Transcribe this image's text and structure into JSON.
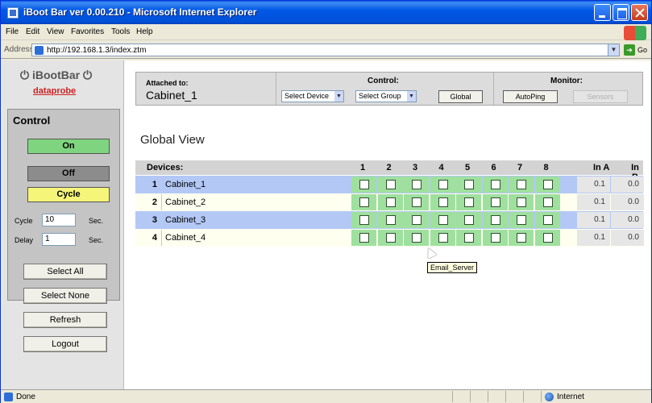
{
  "window": {
    "title": "iBoot Bar ver 0.00.210 - Microsoft Internet Explorer"
  },
  "menu": [
    "File",
    "Edit",
    "View",
    "Favorites",
    "Tools",
    "Help"
  ],
  "address": {
    "label": "Address",
    "url": "http://192.168.1.3/index.ztm",
    "go_label": "Go"
  },
  "logo": {
    "product": "iBootBar",
    "brand": "dataprobe"
  },
  "control": {
    "title": "Control",
    "on_label": "On",
    "off_label": "Off",
    "cycle_label": "Cycle",
    "cycle_field_label": "Cycle",
    "cycle_value": "10",
    "cycle_unit": "Sec.",
    "delay_field_label": "Delay",
    "delay_value": "1",
    "delay_unit": "Sec."
  },
  "side_buttons": {
    "select_all": "Select All",
    "select_none": "Select None",
    "refresh": "Refresh",
    "logout": "Logout"
  },
  "header": {
    "attached_label": "Attached to:",
    "attached_value": "Cabinet_1",
    "control_title": "Control:",
    "select_device": "Select Device",
    "select_group": "Select Group",
    "global_button": "Global",
    "monitor_title": "Monitor:",
    "autoping_button": "AutoPing",
    "sensors_button": "Sensors"
  },
  "view_title": "Global View",
  "grid": {
    "devices_header": "Devices:",
    "outlet_headers": [
      "1",
      "2",
      "3",
      "4",
      "5",
      "6",
      "7",
      "8"
    ],
    "in_a_header": "In A",
    "in_b_header": "In B",
    "rows": [
      {
        "num": "1",
        "name": "Cabinet_1",
        "in_a": "0.1",
        "in_b": "0.0",
        "row_bg": "#b3c8f5",
        "name_bg": "#b3c8f5"
      },
      {
        "num": "2",
        "name": "Cabinet_2",
        "in_a": "0.1",
        "in_b": "0.0",
        "row_bg": "#fffff0",
        "name_bg": "#fffff0"
      },
      {
        "num": "3",
        "name": "Cabinet_3",
        "in_a": "0.1",
        "in_b": "0.0",
        "row_bg": "#b3c8f5",
        "name_bg": "#b3c8f5"
      },
      {
        "num": "4",
        "name": "Cabinet_4",
        "in_a": "0.1",
        "in_b": "0.0",
        "row_bg": "#fffff0",
        "name_bg": "#fffff0"
      }
    ]
  },
  "tooltip": "Email_Server",
  "status": {
    "text": "Done",
    "zone": "Internet"
  },
  "colors": {
    "on_green": "#7fd57f",
    "off_gray": "#8c8c8c",
    "cycle_yellow": "#f5f57a",
    "outlet_green": "#9fe09f"
  }
}
